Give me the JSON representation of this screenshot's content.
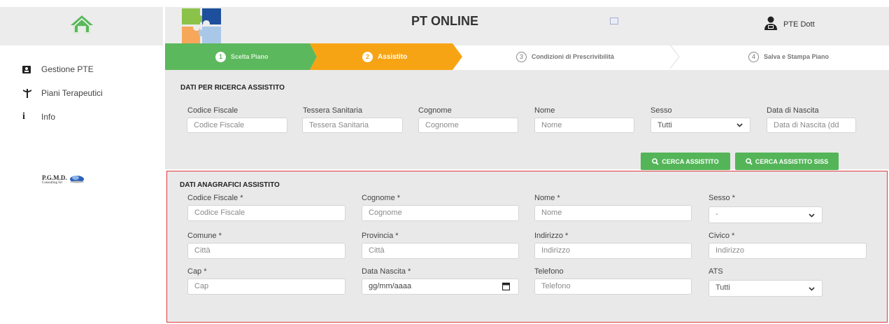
{
  "header": {
    "title": "PT ONLINE",
    "user_name": "PTE Dott"
  },
  "sidebar": {
    "items": [
      {
        "label": "Gestione PTE",
        "icon": "id-card-icon"
      },
      {
        "label": "Piani Terapeutici",
        "icon": "caduceus-icon"
      },
      {
        "label": "Info",
        "icon": "info-icon"
      }
    ],
    "logo_text": "P.G.M.D.",
    "logo_sub": "Consulting Srl"
  },
  "stepper": {
    "steps": [
      {
        "num": "1",
        "label": "Scelta Piano",
        "state": "done"
      },
      {
        "num": "2",
        "label": "Assistito",
        "state": "active"
      },
      {
        "num": "3",
        "label": "Condizioni di Prescrivibilità",
        "state": "pending"
      },
      {
        "num": "4",
        "label": "Salva e Stampa Piano",
        "state": "pending"
      }
    ]
  },
  "search": {
    "title": "DATI PER RICERCA ASSISTITO",
    "fields": [
      {
        "label": "Codice Fiscale",
        "placeholder": "Codice Fiscale"
      },
      {
        "label": "Tessera Sanitaria",
        "placeholder": "Tessera Sanitaria"
      },
      {
        "label": "Cognome",
        "placeholder": "Cognome"
      },
      {
        "label": "Nome",
        "placeholder": "Nome"
      },
      {
        "label": "Sesso",
        "value": "Tutti"
      },
      {
        "label": "Data di Nascita",
        "placeholder": "Data di Nascita (dd"
      }
    ],
    "btn_search": "CERCA ASSISTITO",
    "btn_search_siss": "CERCA ASSISTITO SISS"
  },
  "anagrafica": {
    "title": "DATI ANAGRAFICI ASSISTITO",
    "fields": [
      {
        "label": "Codice Fiscale *",
        "placeholder": "Codice Fiscale"
      },
      {
        "label": "Cognome *",
        "placeholder": "Cognome"
      },
      {
        "label": "Nome *",
        "placeholder": "Nome"
      },
      {
        "label": "Sesso *",
        "value": "-"
      },
      {
        "label": "Comune *",
        "placeholder": "Città"
      },
      {
        "label": "Provincia *",
        "placeholder": "Città"
      },
      {
        "label": "Indirizzo *",
        "placeholder": "Indirizzo"
      },
      {
        "label": "Civico *",
        "placeholder": "Indirizzo"
      },
      {
        "label": "Cap *",
        "placeholder": "Cap"
      },
      {
        "label": "Data Nascita *",
        "placeholder": "gg/mm/aaaa"
      },
      {
        "label": "Telefono",
        "placeholder": "Telefono"
      },
      {
        "label": "ATS",
        "value": "Tutti"
      }
    ]
  },
  "colors": {
    "step_done": "#5cb85c",
    "step_active": "#f7a414",
    "button_green": "#54b558",
    "panel_border": "#e0393e",
    "panel_bg": "#e9e9e9"
  }
}
